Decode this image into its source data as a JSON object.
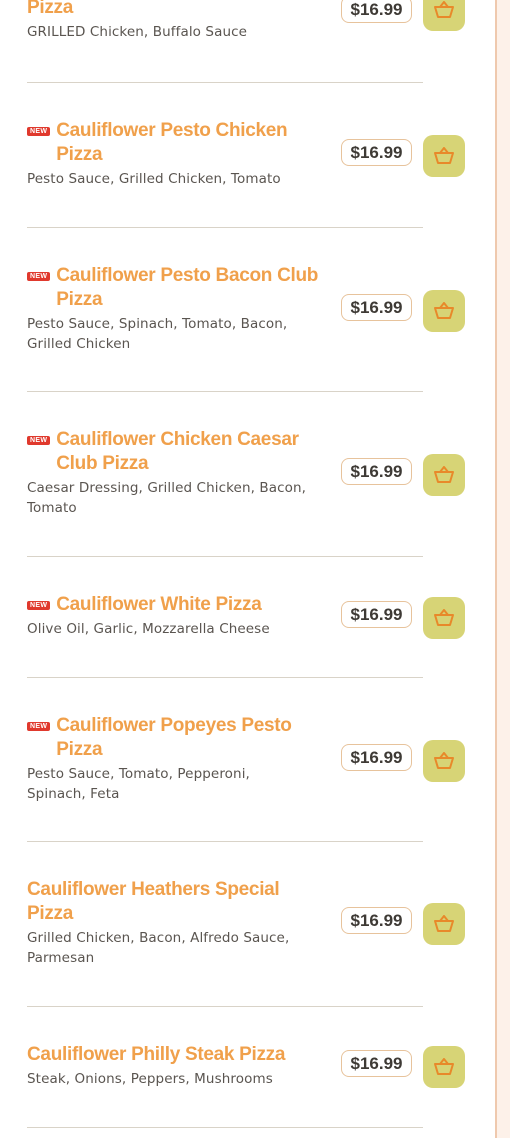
{
  "items": [
    {
      "title": "Pizza",
      "new": false,
      "description": "GRILLED Chicken, Buffalo Sauce",
      "price": "$16.99"
    },
    {
      "title": "Cauliflower Pesto Chicken Pizza",
      "new": true,
      "description": "Pesto Sauce, Grilled Chicken, Tomato",
      "price": "$16.99"
    },
    {
      "title": "Cauliflower Pesto Bacon Club Pizza",
      "new": true,
      "description": "Pesto Sauce, Spinach, Tomato, Bacon, Grilled Chicken",
      "price": "$16.99"
    },
    {
      "title": "Cauliflower Chicken Caesar Club Pizza",
      "new": true,
      "description": "Caesar Dressing, Grilled Chicken, Bacon, Tomato",
      "price": "$16.99"
    },
    {
      "title": "Cauliflower White Pizza",
      "new": true,
      "description": "Olive Oil, Garlic, Mozzarella Cheese",
      "price": "$16.99"
    },
    {
      "title": "Cauliflower Popeyes Pesto Pizza",
      "new": true,
      "description": "Pesto Sauce, Tomato, Pepperoni, Spinach, Feta",
      "price": "$16.99"
    },
    {
      "title": "Cauliflower Heathers Special Pizza",
      "new": false,
      "description": "Grilled Chicken, Bacon, Alfredo Sauce, Parmesan",
      "price": "$16.99"
    },
    {
      "title": "Cauliflower Philly Steak Pizza",
      "new": false,
      "description": "Steak, Onions, Peppers, Mushrooms",
      "price": "$16.99"
    }
  ],
  "badge_label": "NEW",
  "cart_icon": "basket-icon",
  "colors": {
    "title": "#f0a04b",
    "badge": "#e0392d",
    "cart_button": "#d7d476",
    "price_border": "#e7c39c",
    "divider": "#d9d3c8"
  }
}
